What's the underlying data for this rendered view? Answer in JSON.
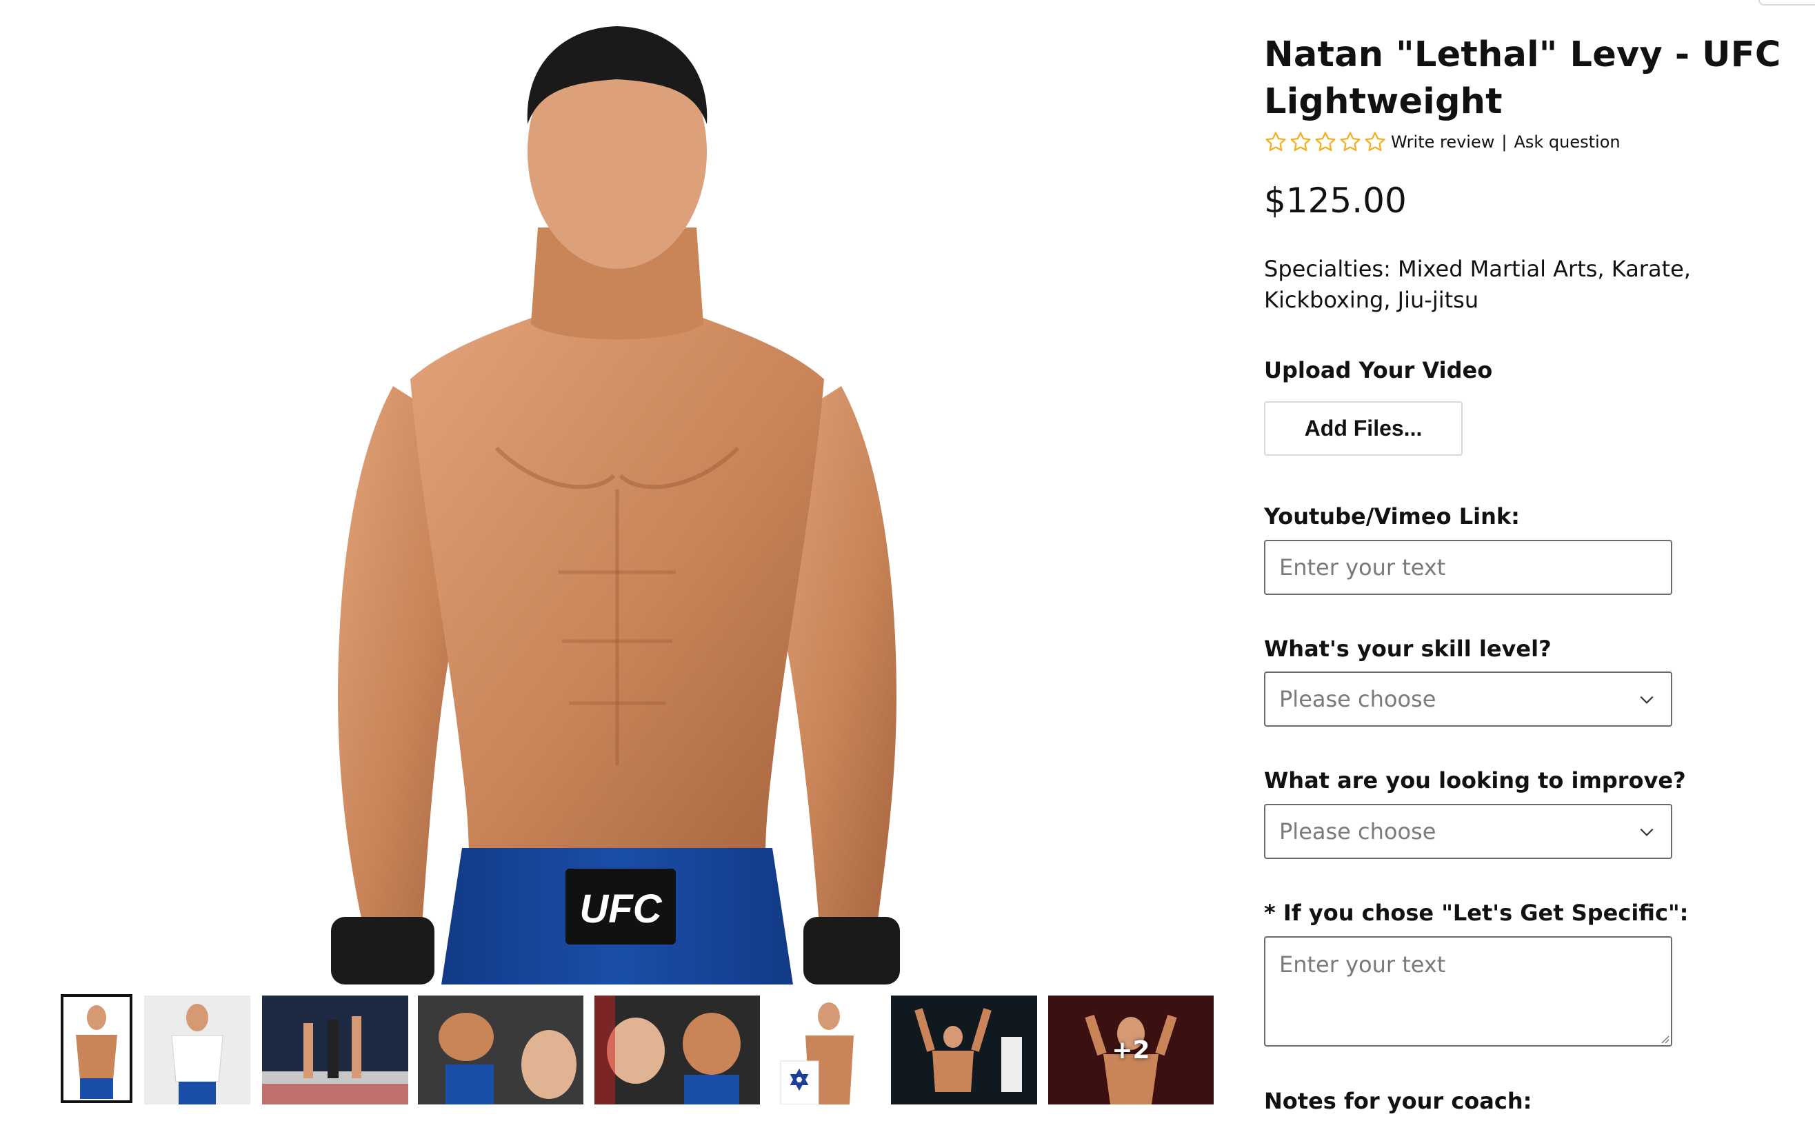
{
  "product": {
    "title": "Natan \"Lethal\" Levy - UFC Lightweight",
    "rating_stars": 0,
    "rating_max": 5,
    "write_review": "Write review",
    "separator": "|",
    "ask_question": "Ask question",
    "price": "$125.00",
    "specialties": "Specialties: Mixed Martial Arts, Karate, Kickboxing, Jiu-jitsu"
  },
  "form": {
    "upload_label": "Upload Your Video",
    "add_files_button": "Add Files...",
    "link_label": "Youtube/Vimeo Link:",
    "link_placeholder": "Enter your text",
    "skill_label": "What's your skill level?",
    "skill_value": "Please choose",
    "improve_label": "What are you looking to improve?",
    "improve_value": "Please choose",
    "specific_label": "* If you chose \"Let's Get Specific\":",
    "specific_placeholder": "Enter your text",
    "notes_label": "Notes for your coach:"
  },
  "gallery": {
    "main_image": "fighter-portrait",
    "shorts_text": "UFC",
    "thumbnails": [
      {
        "name": "thumb-portrait",
        "active": true
      },
      {
        "name": "thumb-white-shirt",
        "active": false
      },
      {
        "name": "thumb-octagon-win",
        "active": false
      },
      {
        "name": "thumb-fight-kick",
        "active": false
      },
      {
        "name": "thumb-fight-punch",
        "active": false
      },
      {
        "name": "thumb-israel-flag",
        "active": false
      },
      {
        "name": "thumb-victory-arms",
        "active": false
      },
      {
        "name": "thumb-weigh-in",
        "active": false
      }
    ],
    "more_count": "+2"
  },
  "colors": {
    "star_outline": "#f2b01e",
    "text": "#111111",
    "border": "#6b6b6b",
    "placeholder": "#7a7a7a",
    "shorts_blue": "#1b4ea8"
  }
}
